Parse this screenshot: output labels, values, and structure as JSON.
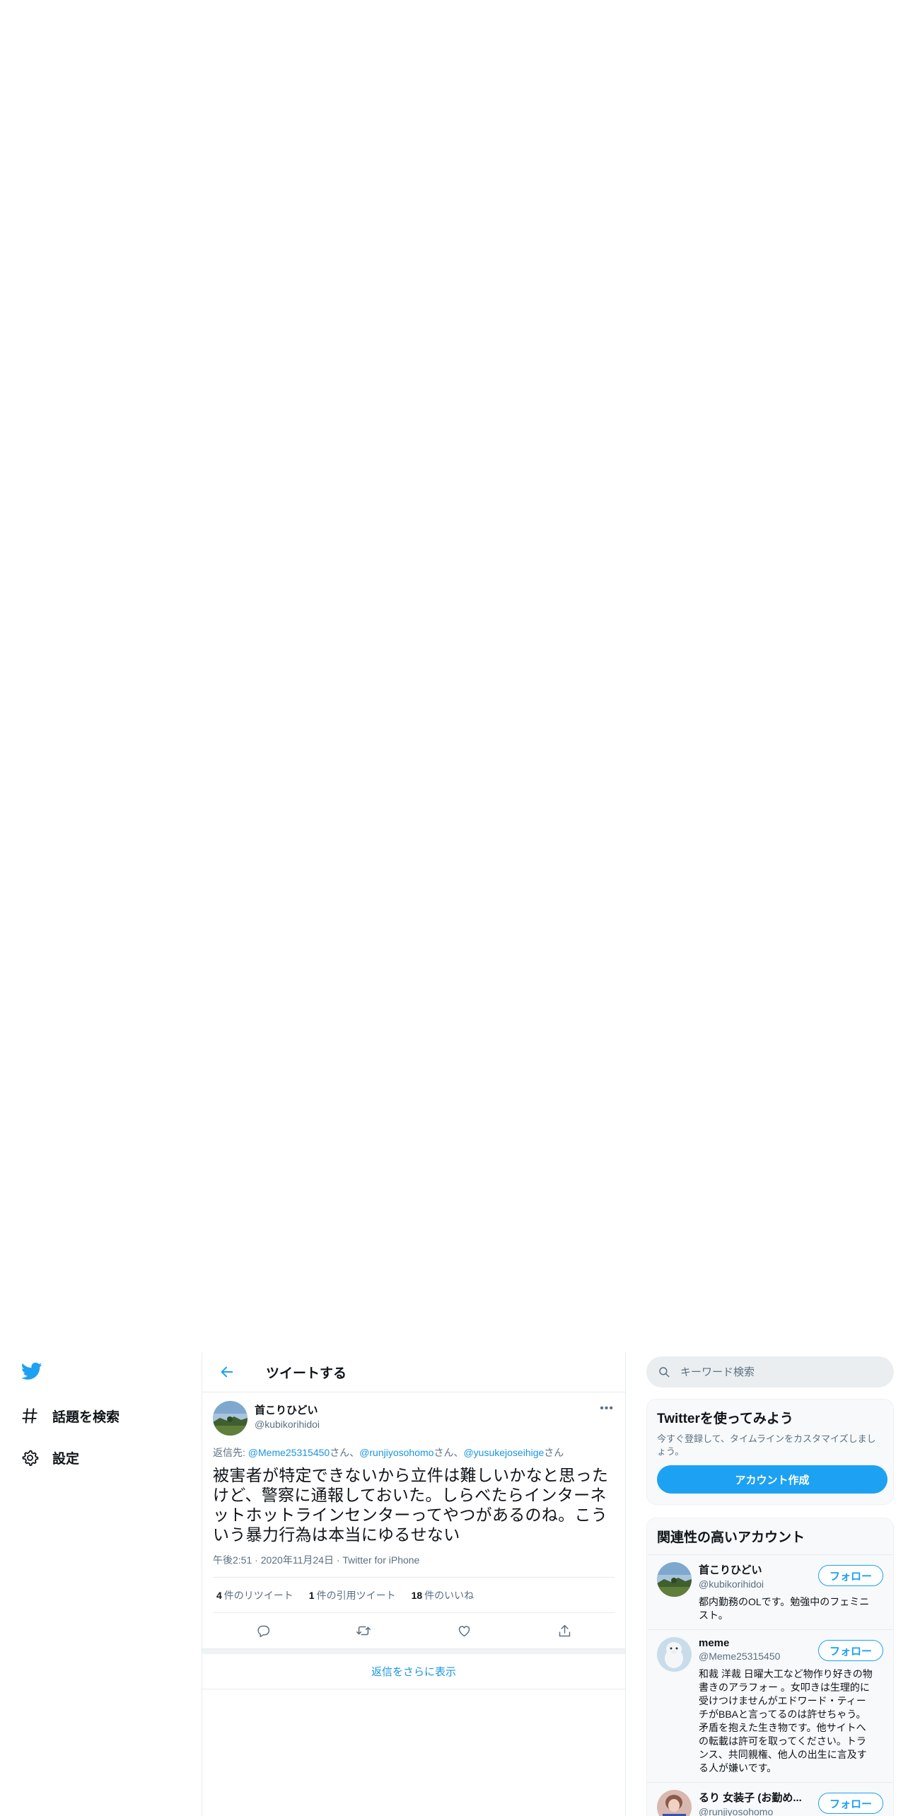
{
  "nav": {
    "items": [
      {
        "label": "話題を検索",
        "icon": "hashtag-icon"
      },
      {
        "label": "設定",
        "icon": "gear-icon"
      }
    ]
  },
  "header": {
    "title": "ツイートする"
  },
  "tweet": {
    "author_name": "首こりひどい",
    "author_handle": "@kubikorihidoi",
    "reply_prefix": "返信先: ",
    "mentions": [
      "@Meme25315450",
      "@runjiyosohomo",
      "@yusukejoseihige"
    ],
    "mention_suffix": "さん",
    "mention_sep": "、",
    "text": "被害者が特定できないから立件は難しいかなと思ったけど、警察に通報しておいた。しらべたらインターネットホットラインセンターってやつがあるのね。こういう暴力行為は本当にゆるせない",
    "time": "午後2:51",
    "dot": " · ",
    "date": "2020年11月24日",
    "source": "Twitter for iPhone",
    "retweets": {
      "count": "4",
      "label": "件のリツイート"
    },
    "quotes": {
      "count": "1",
      "label": "件の引用ツイート"
    },
    "likes": {
      "count": "18",
      "label": "件のいいね"
    },
    "more": "•••"
  },
  "show_more": "返信をさらに表示",
  "search": {
    "placeholder": "キーワード検索"
  },
  "signup": {
    "title": "Twitterを使ってみよう",
    "desc": "今すぐ登録して、タイムラインをカスタマイズしましょう。",
    "button": "アカウント作成"
  },
  "related": {
    "title": "関連性の高いアカウント",
    "follow_label": "フォロー",
    "accounts": [
      {
        "name": "首こりひどい",
        "handle": "@kubikorihidoi",
        "bio": "都内勤務のOLです。勉強中のフェミニスト。"
      },
      {
        "name": "meme",
        "handle": "@Meme25315450",
        "bio": "和裁 洋裁 日曜大工など物作り好きの物書きのアラフォー 。女叩きは生理的に受けつけませんがエドワード・ティーチがBBAと言ってるのは許せちゃう。矛盾を抱えた生き物です。他サイトへの転載は許可を取ってください。トランス、共同親権、他人の出生に言及する人が嫌いです。"
      },
      {
        "name": "るり 女装子 (お勤め...",
        "handle": "@runjiyosohomo",
        "bio": ""
      }
    ]
  },
  "colors": {
    "accent": "#1da1f2",
    "link": "#1b95e0",
    "muted": "#5b7083",
    "border": "#e6ecf0"
  }
}
